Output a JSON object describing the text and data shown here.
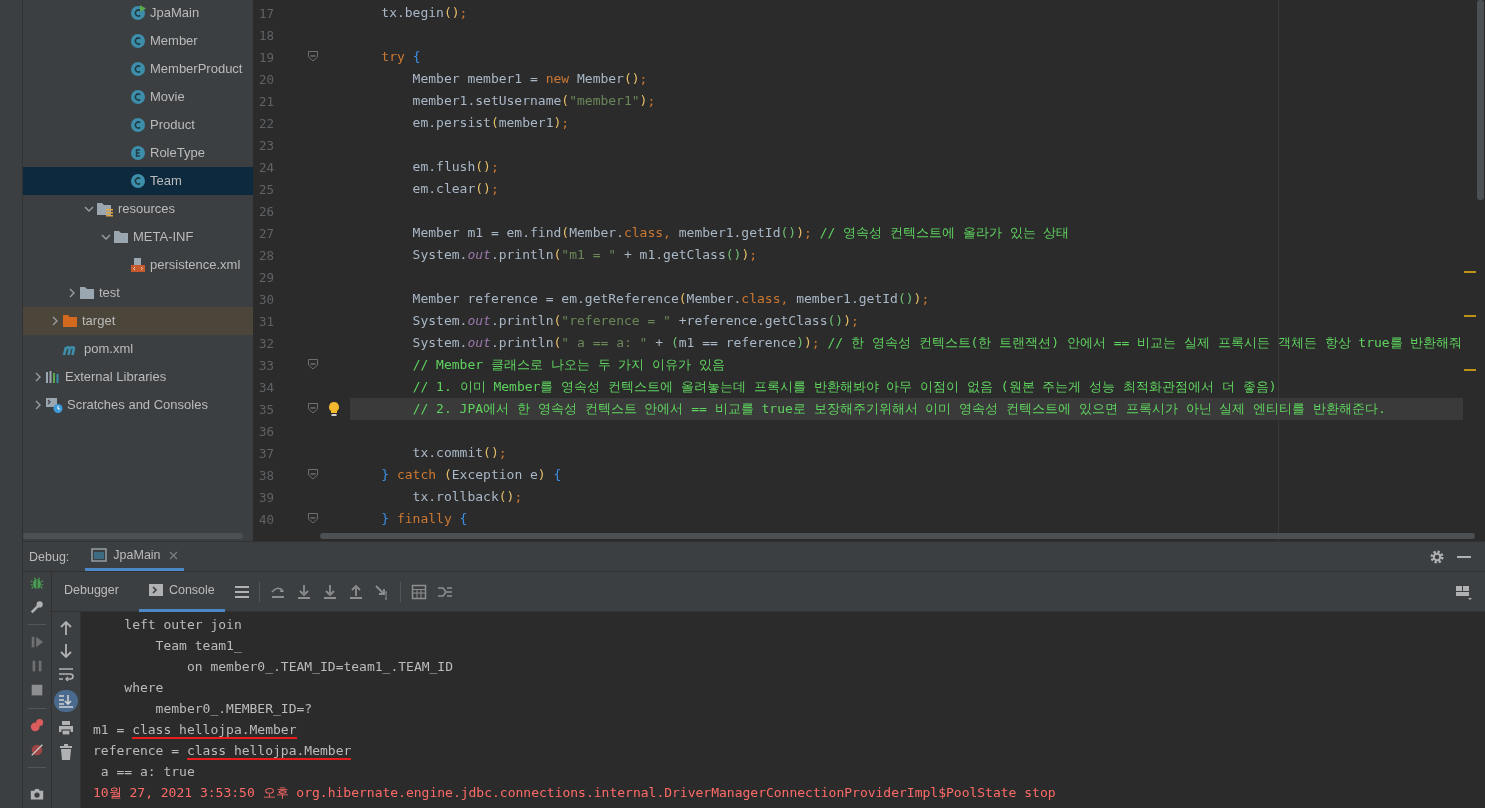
{
  "project_tree": [
    {
      "children": [
        {
          "children": [
            {
              "children": [
                {
                  "children": [
                    {
                      "children": [
                        {
                          "label": "JpaMain",
                          "kind": "main-class",
                          "selected": false
                        },
                        {
                          "label": "Member",
                          "kind": "class",
                          "selected": false
                        },
                        {
                          "label": "MemberProduct",
                          "kind": "class",
                          "selected": false
                        },
                        {
                          "label": "Movie",
                          "kind": "class",
                          "selected": false
                        },
                        {
                          "label": "Product",
                          "kind": "class",
                          "selected": false
                        },
                        {
                          "label": "RoleType",
                          "kind": "enum",
                          "selected": false
                        },
                        {
                          "label": "Team",
                          "kind": "class",
                          "selected": true
                        }
                      ]
                    }
                  ]
                },
                {
                  "label": "resources",
                  "kind": "resource-folder",
                  "expanded": true,
                  "selected": false,
                  "children": [
                    {
                      "label": "META-INF",
                      "kind": "folder",
                      "expanded": true,
                      "selected": false,
                      "children": [
                        {
                          "label": "persistence.xml",
                          "kind": "xml",
                          "selected": false
                        }
                      ]
                    }
                  ]
                }
              ]
            },
            {
              "label": "test",
              "kind": "folder",
              "expanded": false,
              "selected": false
            }
          ]
        },
        {
          "label": "target",
          "kind": "excluded-folder",
          "expanded": false,
          "selected": false
        },
        {
          "label": "pom.xml",
          "kind": "maven",
          "selected": false
        }
      ]
    },
    {
      "label": "External Libraries",
      "kind": "libraries",
      "expanded": false,
      "selected": false
    },
    {
      "label": "Scratches and Consoles",
      "kind": "scratches",
      "expanded": false,
      "selected": false
    }
  ],
  "editor": {
    "lines": [
      {
        "no": "17",
        "current": false,
        "foldable": false,
        "bulb": false,
        "text": "    tx.begin();"
      },
      {
        "no": "18",
        "current": false,
        "foldable": false,
        "bulb": false
      },
      {
        "no": "19",
        "current": false,
        "foldable": true,
        "bulb": false,
        "text": "    try {"
      },
      {
        "no": "20",
        "current": false,
        "foldable": false,
        "bulb": false,
        "text": "        Member member1 = new Member();"
      },
      {
        "no": "21",
        "current": false,
        "foldable": false,
        "bulb": false,
        "text": "        member1.setUsername(\"member1\");"
      },
      {
        "no": "22",
        "current": false,
        "foldable": false,
        "bulb": false,
        "text": "        em.persist(member1);"
      },
      {
        "no": "23",
        "current": false,
        "foldable": false,
        "bulb": false
      },
      {
        "no": "24",
        "current": false,
        "foldable": false,
        "bulb": false,
        "text": "        em.flush();"
      },
      {
        "no": "25",
        "current": false,
        "foldable": false,
        "bulb": false,
        "text": "        em.clear();"
      },
      {
        "no": "26",
        "current": false,
        "foldable": false,
        "bulb": false
      },
      {
        "no": "27",
        "current": false,
        "foldable": false,
        "bulb": false,
        "text": "        Member m1 = em.find(Member.class, member1.getId()); // 영속성 컨텍스트에 올라가 있는 상태"
      },
      {
        "no": "28",
        "current": false,
        "foldable": false,
        "bulb": false,
        "text": "        System.out.println(\"m1 = \" + m1.getClass());"
      },
      {
        "no": "29",
        "current": false,
        "foldable": false,
        "bulb": false
      },
      {
        "no": "30",
        "current": false,
        "foldable": false,
        "bulb": false,
        "text": "        Member reference = em.getReference(Member.class, member1.getId());"
      },
      {
        "no": "31",
        "current": false,
        "foldable": false,
        "bulb": false,
        "text": "        System.out.println(\"reference = \" +reference.getClass());"
      },
      {
        "no": "32",
        "current": false,
        "foldable": false,
        "bulb": false,
        "text": "        System.out.println(\" a == a: \" + (m1 == reference)); // 한 영속성 컨텍스트(한 트랜잭션) 안에서 == 비교는 실제 프록시든 객체든 항상 true를 반환해줘"
      },
      {
        "no": "33",
        "current": false,
        "foldable": true,
        "bulb": false,
        "text": "        // Member 클래스로 나오는 두 가지 이유가 있음"
      },
      {
        "no": "34",
        "current": false,
        "foldable": false,
        "bulb": false,
        "text": "        // 1. 이미 Member를 영속성 컨텍스트에 올려놓는데 프록시를 반환해봐야 아무 이점이 없음 (원본 주는게 성능 최적화관점에서 더 좋음)"
      },
      {
        "no": "35",
        "current": true,
        "foldable": true,
        "bulb": true,
        "text": "        // 2. JPA에서 한 영속성 컨텍스트 안에서 == 비교를 true로 보장해주기위해서 이미 영속성 컨텍스트에 있으면 프록시가 아닌 실제 엔티티를 반환해준다."
      },
      {
        "no": "36",
        "current": false,
        "foldable": false,
        "bulb": false
      },
      {
        "no": "37",
        "current": false,
        "foldable": false,
        "bulb": false,
        "text": "        tx.commit();"
      },
      {
        "no": "38",
        "current": false,
        "foldable": true,
        "bulb": false,
        "text": "    } catch (Exception e) {"
      },
      {
        "no": "39",
        "current": false,
        "foldable": false,
        "bulb": false,
        "text": "        tx.rollback();"
      },
      {
        "no": "40",
        "current": false,
        "foldable": true,
        "bulb": false,
        "text": "    } finally {"
      }
    ]
  },
  "debug": {
    "title": "Debug:",
    "session_tab": {
      "label": "JpaMain",
      "selected": true
    },
    "tabs": [
      {
        "label": "Debugger",
        "selected": false
      },
      {
        "label": "Console",
        "selected": true
      }
    ],
    "console": {
      "scroll_to_end": true,
      "lines": [
        {
          "kind": "normal",
          "segments": [
            {
              "t": "    left outer join",
              "marked": false
            }
          ]
        },
        {
          "kind": "normal",
          "segments": [
            {
              "t": "        Team team1_",
              "marked": false
            }
          ]
        },
        {
          "kind": "normal",
          "segments": [
            {
              "t": "            on member0_.TEAM_ID=team1_.TEAM_ID",
              "marked": false
            }
          ]
        },
        {
          "kind": "normal",
          "segments": [
            {
              "t": "    where",
              "marked": false
            }
          ]
        },
        {
          "kind": "normal",
          "segments": [
            {
              "t": "        member0_.MEMBER_ID=?",
              "marked": false
            }
          ]
        },
        {
          "kind": "normal",
          "segments": [
            {
              "t": "m1 = ",
              "marked": false
            },
            {
              "t": "class hellojpa.Member",
              "marked": true
            }
          ]
        },
        {
          "kind": "normal",
          "segments": [
            {
              "t": "reference = ",
              "marked": false
            },
            {
              "t": "class hellojpa.Member",
              "marked": true
            }
          ]
        },
        {
          "kind": "normal",
          "segments": [
            {
              "t": " a == a: true",
              "marked": false
            }
          ]
        },
        {
          "kind": "error",
          "segments": [
            {
              "t": "10월 27, 2021 3:53:50 오후 org.hibernate.engine.jdbc.connections.internal.DriverManagerConnectionProviderImpl$PoolState stop",
              "marked": false
            }
          ]
        }
      ]
    }
  }
}
